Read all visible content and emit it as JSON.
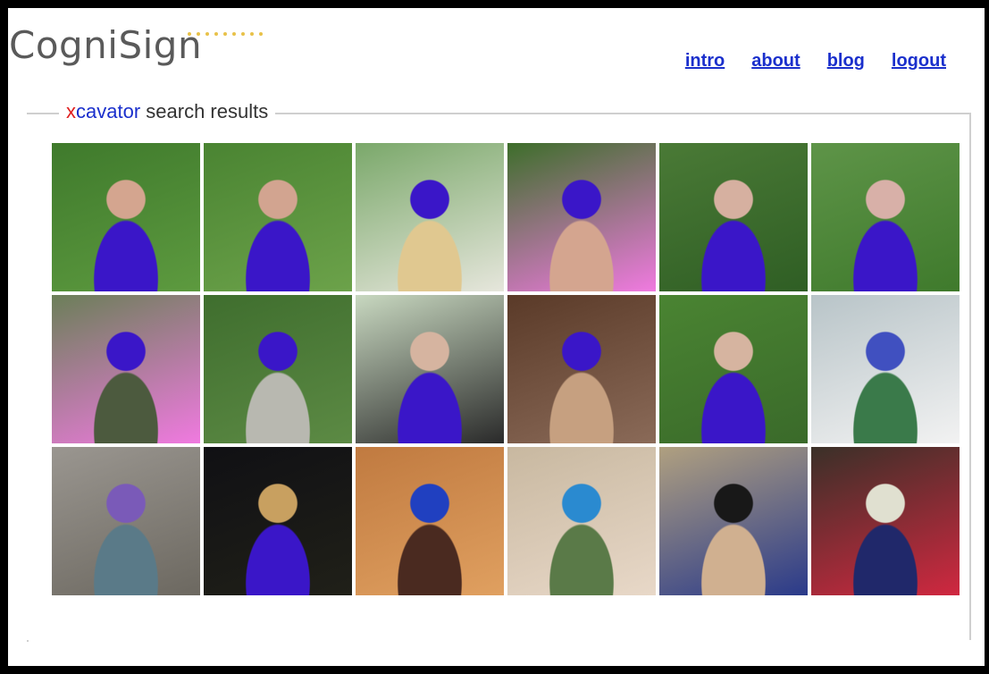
{
  "logo": {
    "text": "CogniSign"
  },
  "nav": {
    "items": [
      {
        "label": "intro"
      },
      {
        "label": "about"
      },
      {
        "label": "blog"
      },
      {
        "label": "logout"
      }
    ]
  },
  "results": {
    "title_x": "x",
    "title_brand": "cavator",
    "title_rest": " search results"
  },
  "thumbnails": [
    [
      {
        "colors": [
          "#3f7a2c",
          "#5d9a3f",
          "#d4a58f",
          "#3a16c8"
        ]
      },
      {
        "colors": [
          "#4a8432",
          "#6ca24a",
          "#d2a490",
          "#3a16c8"
        ]
      },
      {
        "colors": [
          "#7aa86a",
          "#e6e6dc",
          "#3a16c8",
          "#e0c890"
        ]
      },
      {
        "colors": [
          "#3d6e2a",
          "#f07ae0",
          "#3a16c8",
          "#d4a58f"
        ]
      },
      {
        "colors": [
          "#4a7a36",
          "#2f5e24",
          "#d6b0a0",
          "#3a16c8"
        ]
      },
      {
        "colors": [
          "#5e9448",
          "#3f7a2c",
          "#d8b0a8",
          "#3a16c8"
        ]
      }
    ],
    [
      {
        "colors": [
          "#6b7f58",
          "#f07ae0",
          "#3a16c8",
          "#4c5a3e"
        ]
      },
      {
        "colors": [
          "#3f6e2e",
          "#5c8a44",
          "#3a16c8",
          "#b8b8b0"
        ]
      },
      {
        "colors": [
          "#c8d8c0",
          "#2a2a2a",
          "#d6b4a0",
          "#3a16c8"
        ]
      },
      {
        "colors": [
          "#5a3a28",
          "#8a6a58",
          "#3a16c8",
          "#c6a080"
        ]
      },
      {
        "colors": [
          "#4a8432",
          "#3a6a2a",
          "#d6b4a0",
          "#3a16c8"
        ]
      },
      {
        "colors": [
          "#b8c4c8",
          "#f2f2f2",
          "#4050c0",
          "#3a7a4a"
        ]
      }
    ],
    [
      {
        "colors": [
          "#9a9690",
          "#6c6860",
          "#7a5ab8",
          "#5a7a88"
        ]
      },
      {
        "colors": [
          "#101014",
          "#202018",
          "#c8a060",
          "#3a16c8"
        ]
      },
      {
        "colors": [
          "#c07a40",
          "#e0a060",
          "#2040c0",
          "#4a2a20"
        ]
      },
      {
        "colors": [
          "#c8b8a0",
          "#e8d8c8",
          "#2a8ad0",
          "#5a7a48"
        ]
      },
      {
        "colors": [
          "#b0a080",
          "#2a3a8a",
          "#181818",
          "#d0b090"
        ]
      },
      {
        "colors": [
          "#3a3028",
          "#d02840",
          "#e0e0d0",
          "#20286a"
        ]
      }
    ]
  ]
}
